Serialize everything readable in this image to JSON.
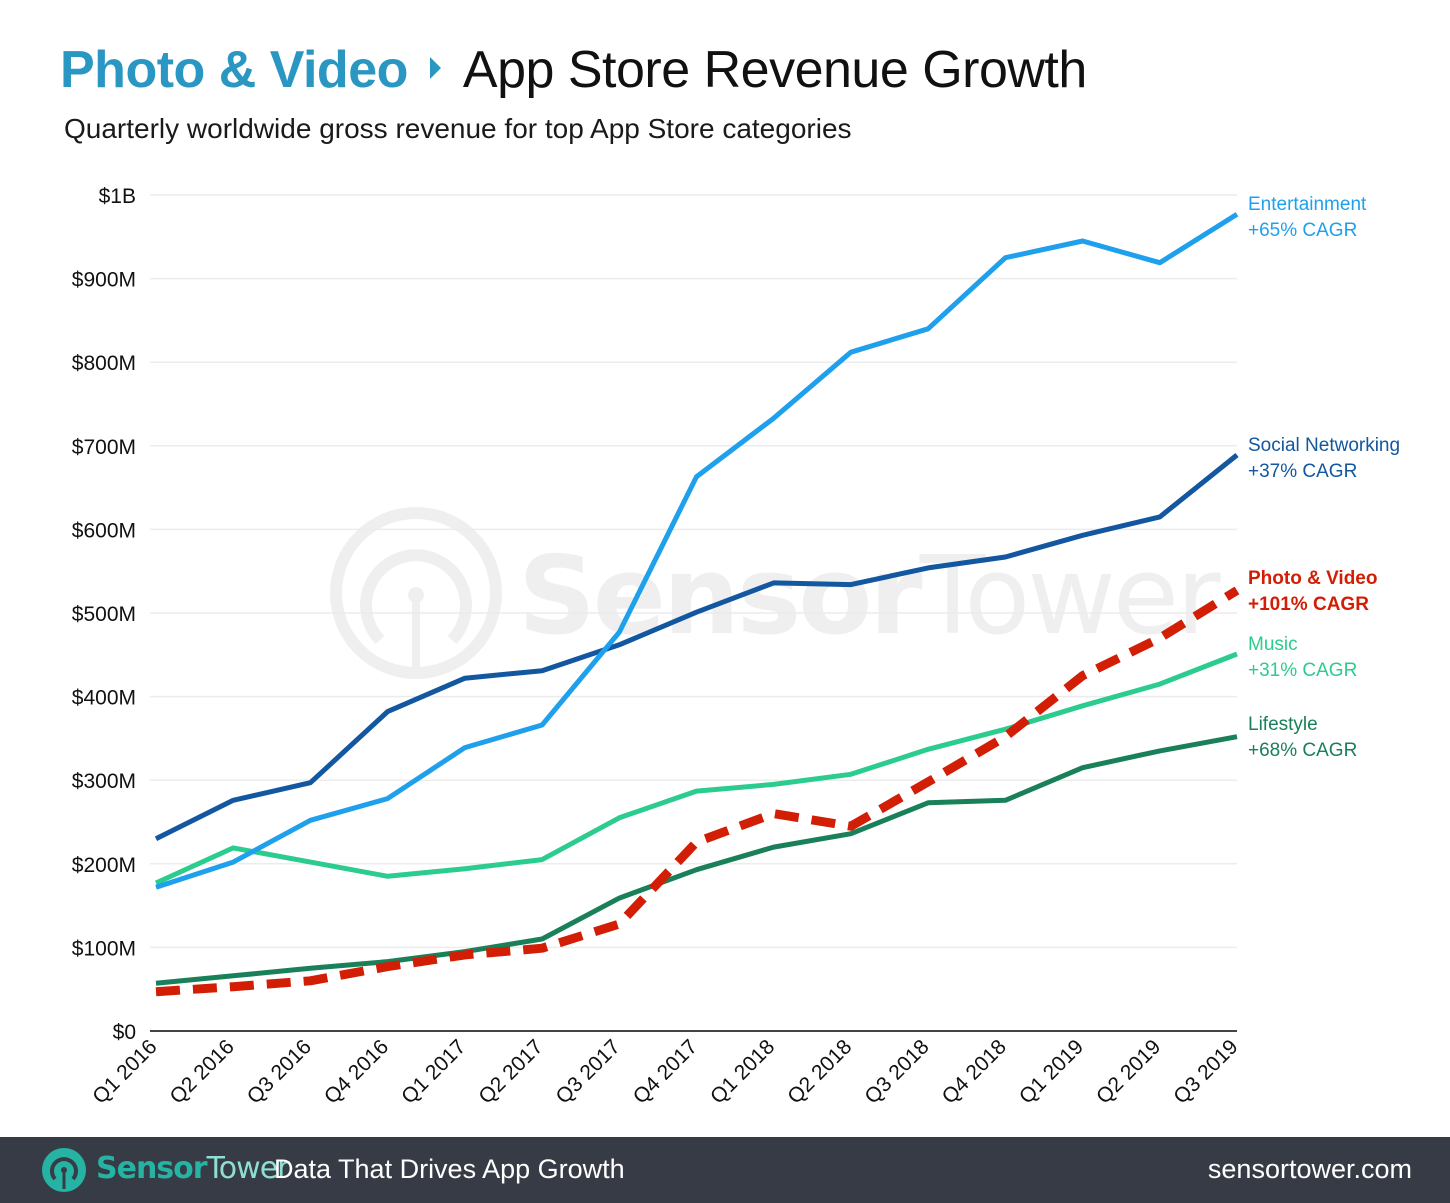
{
  "header": {
    "title_accent": "Photo & Video",
    "title_separator_icon": "triangle-right-icon",
    "title_main": "App Store Revenue Growth",
    "subtitle": "Quarterly worldwide gross revenue for top App Store categories"
  },
  "watermark": {
    "text_bold": "Sensor",
    "text_light": "Tower",
    "icon": "sensor-tower-logo-icon"
  },
  "footer": {
    "brand_bold": "Sensor",
    "brand_light": "Tower",
    "tagline": "Data That Drives App Growth",
    "site": "sensortower.com",
    "logo_icon": "sensor-tower-logo-icon",
    "background": "#363b45"
  },
  "chart_data": {
    "type": "line",
    "title": "App Store Revenue Growth",
    "subtitle": "Quarterly worldwide gross revenue for top App Store categories",
    "xlabel": "",
    "ylabel": "",
    "ylim": [
      0,
      1000
    ],
    "y_unit": "USD millions",
    "grid": true,
    "legend": "right (end-of-line labels)",
    "yticks": [
      0,
      100,
      200,
      300,
      400,
      500,
      600,
      700,
      800,
      900,
      1000
    ],
    "ytick_labels": [
      "$0",
      "$100M",
      "$200M",
      "$300M",
      "$400M",
      "$500M",
      "$600M",
      "$700M",
      "$800M",
      "$900M",
      "$1B"
    ],
    "categories": [
      "Q1 2016",
      "Q2 2016",
      "Q3 2016",
      "Q4 2016",
      "Q1 2017",
      "Q2 2017",
      "Q3 2017",
      "Q4 2017",
      "Q1 2018",
      "Q2 2018",
      "Q3 2018",
      "Q4 2018",
      "Q1 2019",
      "Q2 2019",
      "Q3 2019"
    ],
    "series": [
      {
        "name": "Entertainment",
        "cagr": "+65% CAGR",
        "color": "#1ea0ec",
        "dashed": false,
        "values": [
          172,
          202,
          252,
          278,
          339,
          366,
          477,
          663,
          733,
          812,
          840,
          925,
          945,
          919,
          977
        ]
      },
      {
        "name": "Social Networking",
        "cagr": "+37% CAGR",
        "color": "#1257a0",
        "dashed": false,
        "values": [
          230,
          276,
          297,
          382,
          422,
          431,
          462,
          501,
          536,
          534,
          554,
          567,
          593,
          615,
          689
        ]
      },
      {
        "name": "Photo & Video",
        "cagr": "+101% CAGR",
        "color": "#d11e05",
        "dashed": true,
        "values": [
          47,
          53,
          60,
          77,
          91,
          99,
          128,
          226,
          260,
          245,
          298,
          352,
          425,
          470,
          527
        ]
      },
      {
        "name": "Music",
        "cagr": "+31% CAGR",
        "color": "#2ccc8e",
        "dashed": false,
        "values": [
          177,
          219,
          202,
          185,
          194,
          205,
          255,
          287,
          295,
          307,
          337,
          361,
          389,
          415,
          451
        ]
      },
      {
        "name": "Lifestyle",
        "cagr": "+68% CAGR",
        "color": "#19805a",
        "dashed": false,
        "values": [
          57,
          66,
          75,
          83,
          95,
          110,
          159,
          193,
          220,
          236,
          273,
          276,
          315,
          335,
          352
        ]
      }
    ]
  }
}
